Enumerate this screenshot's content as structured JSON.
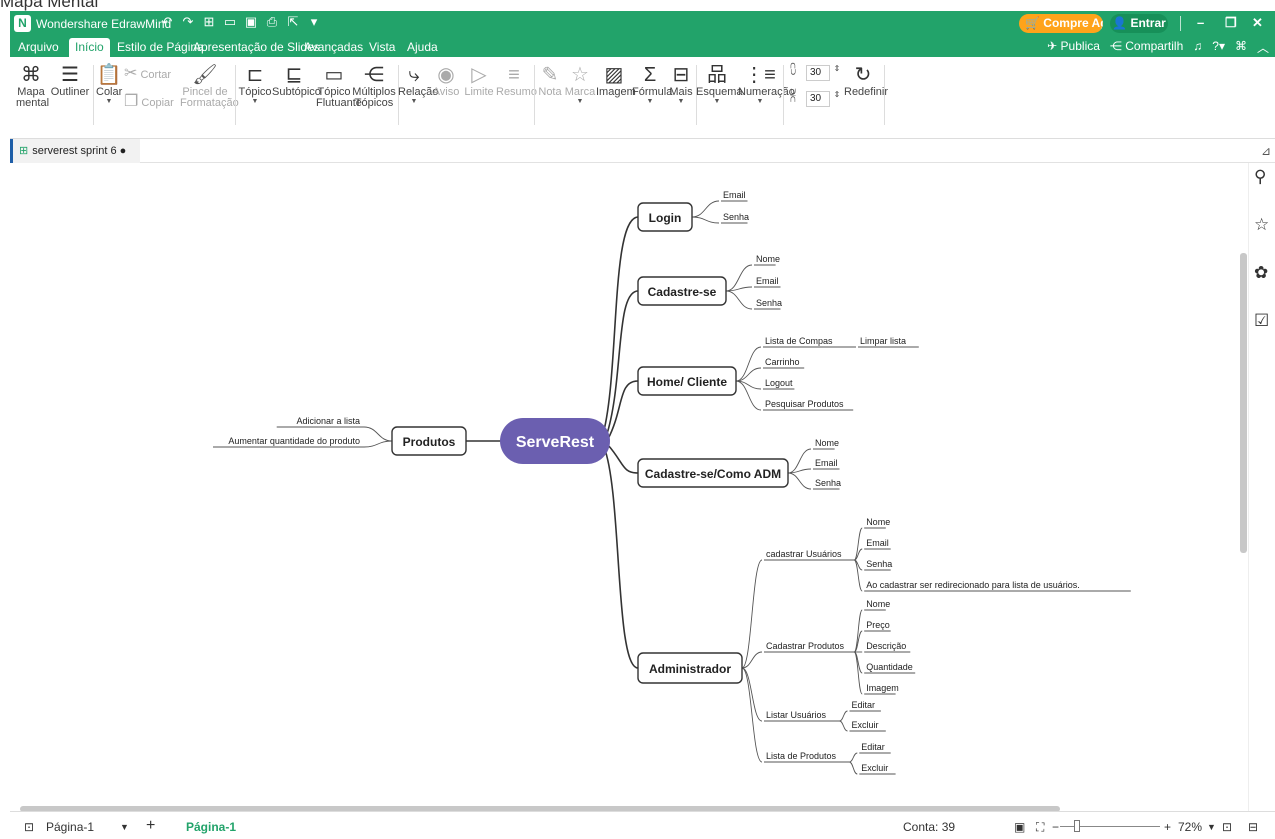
{
  "page_header": "Mapa Mental",
  "titlebar": {
    "app_name": "Wondershare EdrawMind",
    "quick_icons": [
      "undo-icon",
      "redo-icon",
      "new-icon",
      "open-icon",
      "save-icon",
      "print-icon",
      "export-icon",
      "more-icon"
    ],
    "buy_label": "Compre Ago",
    "login_label": "Entrar"
  },
  "menu": {
    "items": [
      "Arquivo",
      "Início",
      "Estilo de Página",
      "Apresentação de Slides",
      "Avançadas",
      "Vista",
      "Ajuda"
    ],
    "active": "Início",
    "publish_label": "Publica",
    "share_label": "Compartilh"
  },
  "ribbon": {
    "mindmap": [
      "Mapa",
      "mental"
    ],
    "outliner": "Outliner",
    "paste": "Colar",
    "cut": "Cortar",
    "copy": "Copiar",
    "format_painter": [
      "Pincel de",
      "Formatação"
    ],
    "topic": "Tópico",
    "subtopic": "Subtópico",
    "floating": [
      "Tópico",
      "Flutuante"
    ],
    "multiple": [
      "Múltiplos",
      "Tópicos"
    ],
    "relation": "Relação",
    "callout": "Aviso",
    "boundary": "Limite",
    "summary": "Resumo",
    "note": "Nota",
    "mark": "Marca",
    "image": "Imagem",
    "formula": "Fórmula",
    "more": "Mais",
    "layout": "Esquema",
    "numbering": "Numeração",
    "spacing_h": "30",
    "spacing_v": "30",
    "reset": "Redefinir"
  },
  "document": {
    "tab_name": "serverest sprint 6"
  },
  "mindmap": {
    "central": "ServeRest",
    "left": {
      "label": "Produtos",
      "children": [
        "Adicionar a lista",
        "Aumentar quantidade do produto"
      ]
    },
    "branches": [
      {
        "label": "Login",
        "children": [
          "Email",
          "Senha"
        ]
      },
      {
        "label": "Cadastre-se",
        "children": [
          "Nome",
          "Email",
          "Senha"
        ]
      },
      {
        "label": "Home/ Cliente",
        "children": [
          "Lista de Compas",
          "Carrinho",
          "Logout",
          "Pesquisar Produtos"
        ],
        "grandchild": "Limpar lista"
      },
      {
        "label": "Cadastre-se/Como ADM",
        "children": [
          "Nome",
          "Email",
          "Senha"
        ]
      },
      {
        "label": "Administrador",
        "groups": [
          {
            "label": "cadastrar Usuários",
            "children": [
              "Nome",
              "Email",
              "Senha",
              "Ao cadastrar ser redirecionado para lista de usuários."
            ]
          },
          {
            "label": "Cadastrar Produtos",
            "children": [
              "Nome",
              "Preço",
              "Descrição",
              "Quantidade",
              "Imagem"
            ]
          },
          {
            "label": "Listar Usuários",
            "children": [
              "Editar",
              "Excluir"
            ]
          },
          {
            "label": "Lista de Produtos",
            "children": [
              "Editar",
              "Excluir"
            ]
          }
        ]
      }
    ],
    "colors": {
      "central_fill": "#6b5fb0",
      "line": "#333333"
    }
  },
  "status": {
    "page_select": "Página-1",
    "page_tab": "Página-1",
    "count": "Conta: 39",
    "zoom": "72%"
  },
  "colors": {
    "brand": "#22a36a",
    "buy": "#ffa31a"
  }
}
